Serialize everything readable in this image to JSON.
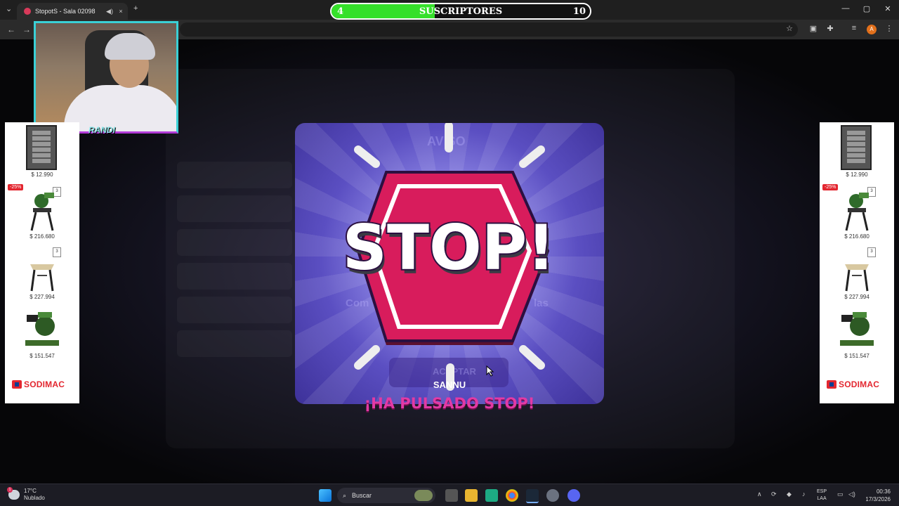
{
  "browser": {
    "tab_title": "StopotS - Sala 02098",
    "new_tab": "+",
    "tab_close": "×",
    "tab_sound_icon": "speaker-icon",
    "window_controls": [
      "—",
      "▢",
      "✕"
    ]
  },
  "subscribers": {
    "current": "4",
    "label": "SUSCRIPTORES",
    "goal": "10",
    "progress_fraction": 0.4,
    "fill_color": "#35e02a"
  },
  "webcam": {
    "name": "RANDI"
  },
  "ads": {
    "left": {
      "items": [
        {
          "price": "$ 12.990",
          "badge": ""
        },
        {
          "price": "$ 216.680",
          "badge": "-25%"
        },
        {
          "price": "$ 227.994",
          "badge": ""
        },
        {
          "price": "$ 151.547",
          "badge": ""
        }
      ],
      "brand": "SODIMAC"
    },
    "right": {
      "items": [
        {
          "price": "$ 12.990",
          "badge": ""
        },
        {
          "price": "$ 216.680",
          "badge": "-25%"
        },
        {
          "price": "$ 227.994",
          "badge": ""
        },
        {
          "price": "$ 151.547",
          "badge": ""
        }
      ],
      "brand": "SODIMAC"
    }
  },
  "modal": {
    "stop_text": "STOP!",
    "player_name": "SANNU",
    "ghost_title": "AVISO",
    "ghost_button": "ACEPTAR",
    "ghost_body_left": "Com",
    "ghost_body_right": "las",
    "pressed_message": "¡HA PULSADO STOP!",
    "hex_color": "#d81c5c"
  },
  "taskbar": {
    "weather_temp": "17°C",
    "weather_desc": "Nublado",
    "weather_badge": "1",
    "search_placeholder": "Buscar",
    "lang_top": "ESP",
    "lang_bottom": "LAA",
    "time": "00:36",
    "date": "17/3/2026"
  }
}
